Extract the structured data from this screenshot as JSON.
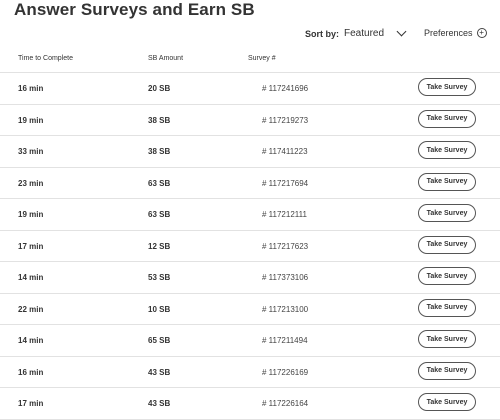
{
  "page": {
    "title": "Answer Surveys and Earn SB"
  },
  "controls": {
    "sort_label": "Sort by:",
    "sort_value": "Featured",
    "preferences_label": "Preferences",
    "preferences_icon": "plus-circle-icon"
  },
  "table": {
    "headers": [
      "Time to Complete",
      "SB Amount",
      "Survey #"
    ],
    "button_label": "Take Survey",
    "rows": [
      {
        "time": "16 min",
        "amount": "20 SB",
        "survey": "# 117241696"
      },
      {
        "time": "19 min",
        "amount": "38 SB",
        "survey": "# 117219273"
      },
      {
        "time": "33 min",
        "amount": "38 SB",
        "survey": "# 117411223"
      },
      {
        "time": "23 min",
        "amount": "63 SB",
        "survey": "# 117217694"
      },
      {
        "time": "19 min",
        "amount": "63 SB",
        "survey": "# 117212111"
      },
      {
        "time": "17 min",
        "amount": "12 SB",
        "survey": "# 117217623"
      },
      {
        "time": "14 min",
        "amount": "53 SB",
        "survey": "# 117373106"
      },
      {
        "time": "22 min",
        "amount": "10 SB",
        "survey": "# 117213100"
      },
      {
        "time": "14 min",
        "amount": "65 SB",
        "survey": "# 117211494"
      },
      {
        "time": "16 min",
        "amount": "43 SB",
        "survey": "# 117226169"
      },
      {
        "time": "17 min",
        "amount": "43 SB",
        "survey": "# 117226164"
      }
    ]
  }
}
